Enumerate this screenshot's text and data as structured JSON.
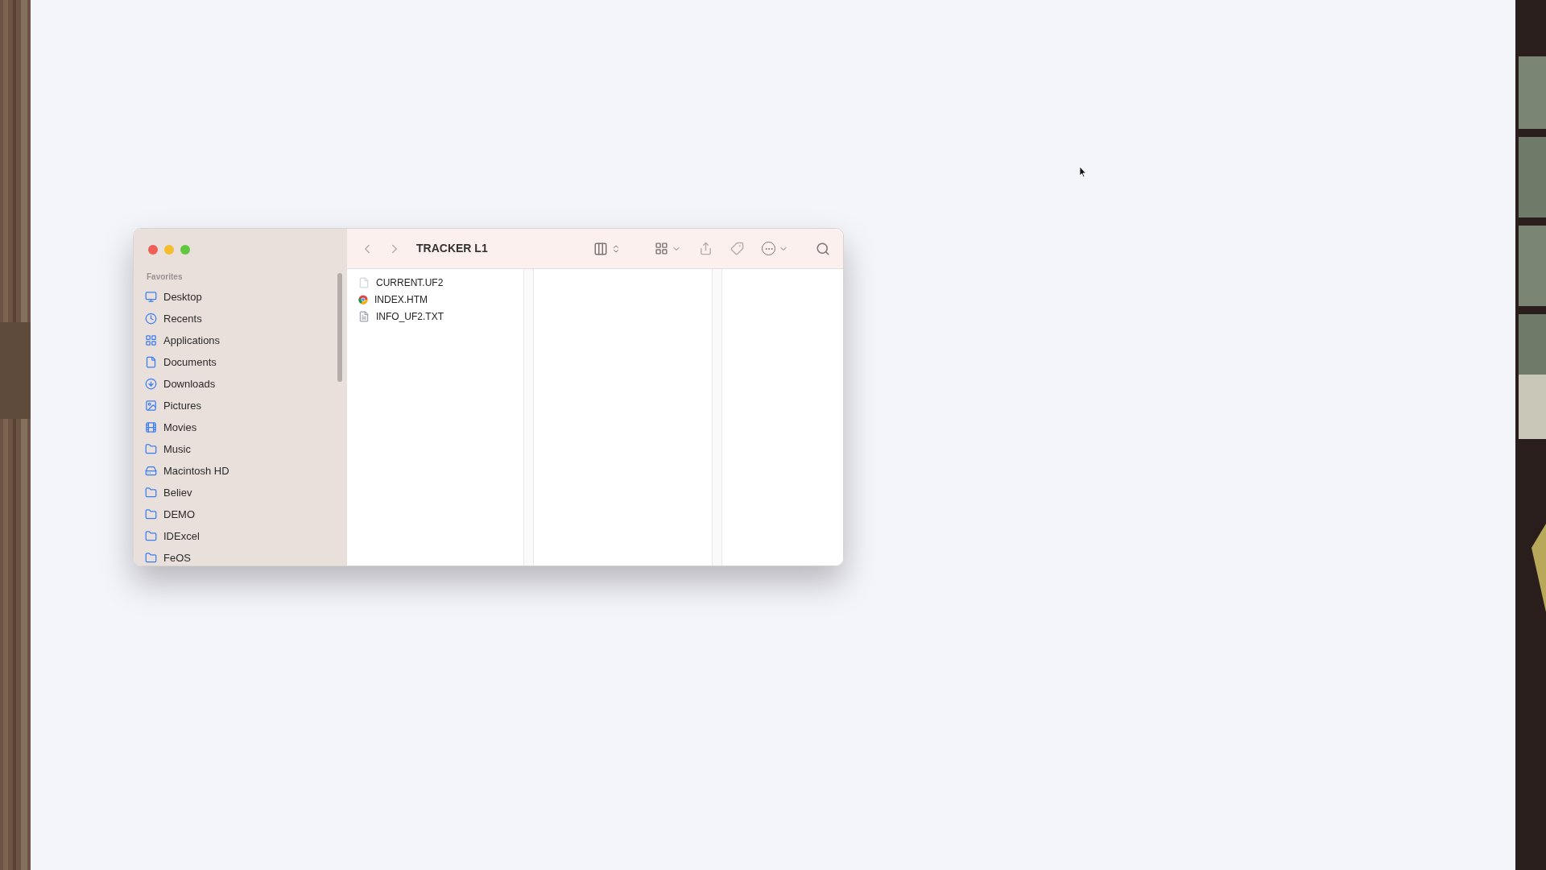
{
  "window": {
    "title": "TRACKER L1"
  },
  "sidebar": {
    "section": "Favorites",
    "items": [
      {
        "label": "Desktop",
        "kind": "desktop"
      },
      {
        "label": "Recents",
        "kind": "recents"
      },
      {
        "label": "Applications",
        "kind": "apps"
      },
      {
        "label": "Documents",
        "kind": "document"
      },
      {
        "label": "Downloads",
        "kind": "download"
      },
      {
        "label": "Pictures",
        "kind": "pictures"
      },
      {
        "label": "Movies",
        "kind": "movies"
      },
      {
        "label": "Music",
        "kind": "folder"
      },
      {
        "label": "Macintosh HD",
        "kind": "drive"
      },
      {
        "label": "Believ",
        "kind": "folder"
      },
      {
        "label": "DEMO",
        "kind": "folder"
      },
      {
        "label": "IDExcel",
        "kind": "folder"
      },
      {
        "label": "FeOS",
        "kind": "folder"
      }
    ]
  },
  "files": [
    {
      "name": "CURRENT.UF2",
      "kind": "blank"
    },
    {
      "name": "INDEX.HTM",
      "kind": "web"
    },
    {
      "name": "INFO_UF2.TXT",
      "kind": "text"
    }
  ]
}
